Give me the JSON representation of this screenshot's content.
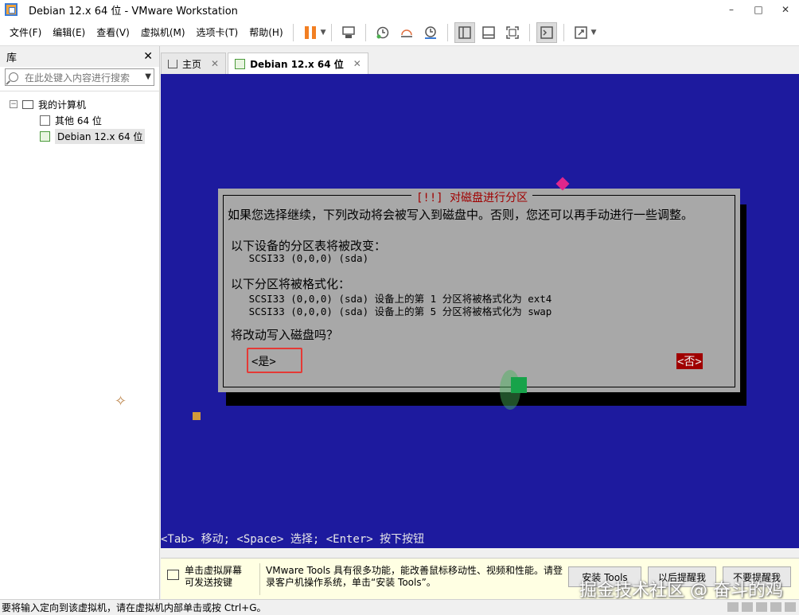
{
  "window": {
    "title": "Debian 12.x 64 位 - VMware Workstation",
    "minimize": "–",
    "maximize": "□",
    "close": "✕"
  },
  "menu": [
    "文件(F)",
    "编辑(E)",
    "查看(V)",
    "虚拟机(M)",
    "选项卡(T)",
    "帮助(H)"
  ],
  "library": {
    "title": "库",
    "close": "✕",
    "search_placeholder": "在此处键入内容进行搜索",
    "tree": {
      "root": "我的计算机",
      "toggle": "−",
      "items": [
        "其他 64 位",
        "Debian 12.x 64 位"
      ]
    }
  },
  "tabs": [
    {
      "label": "主页",
      "close": "✕"
    },
    {
      "label": "Debian 12.x 64 位",
      "close": "✕"
    }
  ],
  "installer": {
    "dialog_title": "[!!] 对磁盘进行分区",
    "lead": "如果您选择继续，下列改动将会被写入到磁盘中。否则，您还可以再手动进行一些调整。",
    "section1_title": "以下设备的分区表将被改变：",
    "section1_line": "   SCSI33 (0,0,0) (sda)",
    "section2_title": "以下分区将被格式化：",
    "section2_lines": [
      "   SCSI33 (0,0,0) (sda) 设备上的第 1 分区将被格式化为 ext4",
      "   SCSI33 (0,0,0) (sda) 设备上的第 5 分区将被格式化为 swap"
    ],
    "question": "将改动写入磁盘吗？",
    "yes": "<是>",
    "no": "<否>",
    "hint": "<Tab> 移动; <Space> 选择; <Enter> 按下按钮"
  },
  "notification": {
    "left": "单击虚拟屏幕\n可发送按键",
    "message": "VMware Tools 具有很多功能，能改善鼠标移动性、视频和性能。请登录客户机操作系统，单击“安装 Tools”。",
    "buttons": [
      "安装 Tools",
      "以后提醒我",
      "不要提醒我"
    ],
    "watermark": "掘金技术社区 @ 奋斗的鸡"
  },
  "status": "要将输入定向到该虚拟机，请在虚拟机内部单击或按 Ctrl+G。",
  "colors": {
    "vm_background": "#1d1a9e",
    "dialog_bg": "#a8a8a8",
    "dialog_title": "#a00000",
    "highlight_box": "#e53935",
    "pause": "#f27f22"
  }
}
